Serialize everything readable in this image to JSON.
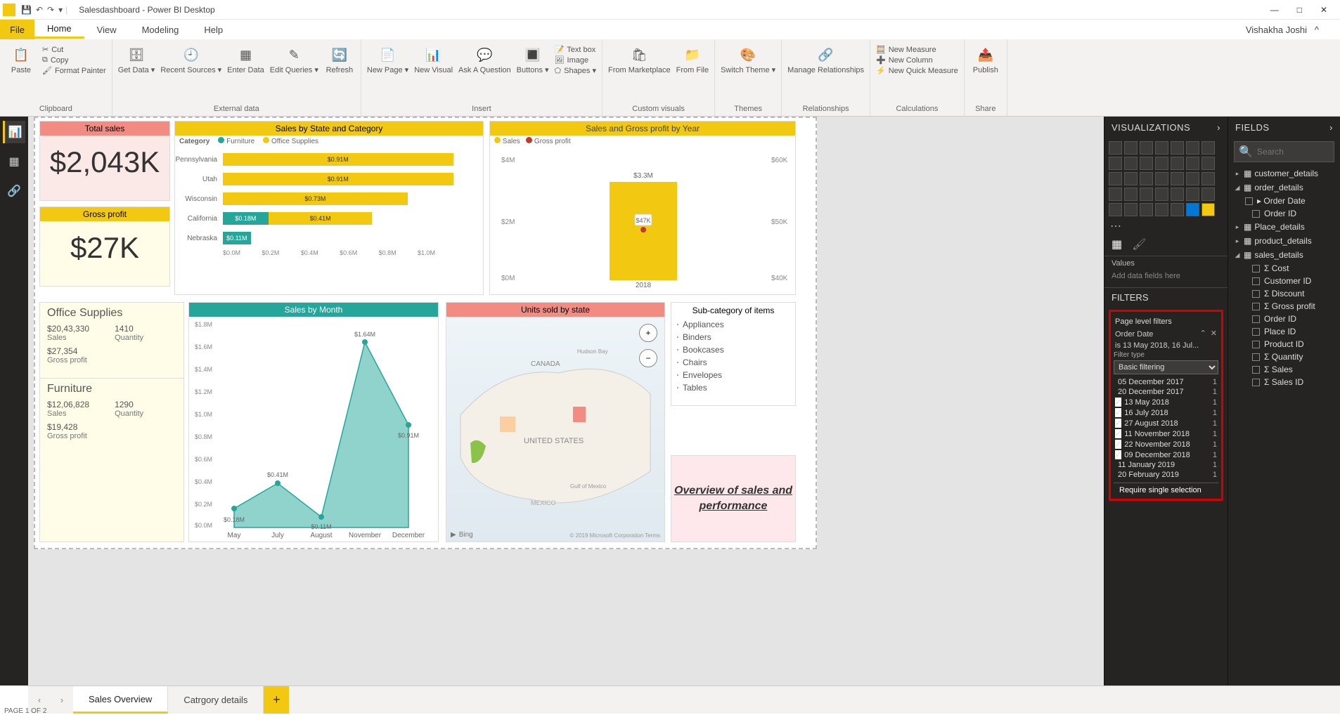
{
  "app": {
    "title": "Salesdashboard - Power BI Desktop",
    "user": "Vishakha Joshi"
  },
  "menu": {
    "file": "File",
    "tabs": [
      "Home",
      "View",
      "Modeling",
      "Help"
    ],
    "active": "Home"
  },
  "ribbon": {
    "clipboard": {
      "paste": "Paste",
      "cut": "Cut",
      "copy": "Copy",
      "format_painter": "Format Painter",
      "label": "Clipboard"
    },
    "external": {
      "get_data": "Get\nData ▾",
      "recent_sources": "Recent\nSources ▾",
      "enter_data": "Enter\nData",
      "edit_queries": "Edit\nQueries ▾",
      "refresh": "Refresh",
      "label": "External data"
    },
    "insert": {
      "new_page": "New\nPage ▾",
      "new_visual": "New\nVisual",
      "ask": "Ask A\nQuestion",
      "buttons": "Buttons\n▾",
      "textbox": "Text box",
      "image": "Image",
      "shapes": "Shapes ▾",
      "label": "Insert"
    },
    "custom": {
      "market": "From\nMarketplace",
      "file": "From\nFile",
      "label": "Custom visuals"
    },
    "themes": {
      "switch": "Switch\nTheme ▾",
      "label": "Themes"
    },
    "rel": {
      "manage": "Manage\nRelationships",
      "label": "Relationships"
    },
    "calc": {
      "new_measure": "New Measure",
      "new_column": "New Column",
      "new_quick": "New Quick Measure",
      "label": "Calculations"
    },
    "share": {
      "publish": "Publish",
      "label": "Share"
    }
  },
  "pane_viz": {
    "title": "VISUALIZATIONS",
    "values": "Values",
    "hint": "Add data fields here",
    "filters": "FILTERS",
    "page_filters": "Page level filters",
    "order_date": "Order Date",
    "summary": "is 13 May 2018, 16 Jul...",
    "filter_type_label": "Filter type",
    "filter_type": "Basic filtering",
    "dates": [
      {
        "label": "05 December 2017",
        "count": "1",
        "checked": false
      },
      {
        "label": "20 December 2017",
        "count": "1",
        "checked": false
      },
      {
        "label": "13 May 2018",
        "count": "1",
        "checked": true
      },
      {
        "label": "16 July 2018",
        "count": "1",
        "checked": true
      },
      {
        "label": "27 August 2018",
        "count": "1",
        "checked": true
      },
      {
        "label": "11 November 2018",
        "count": "1",
        "checked": true
      },
      {
        "label": "22 November 2018",
        "count": "1",
        "checked": true
      },
      {
        "label": "09 December 2018",
        "count": "1",
        "checked": true
      },
      {
        "label": "11 January 2019",
        "count": "1",
        "checked": false
      },
      {
        "label": "20 February 2019",
        "count": "1",
        "checked": false
      }
    ],
    "require_single": "Require single selection"
  },
  "pane_fields": {
    "title": "FIELDS",
    "search_placeholder": "Search",
    "tables": [
      {
        "name": "customer_details",
        "expanded": false
      },
      {
        "name": "order_details",
        "expanded": true,
        "fields": [
          {
            "name": "Order Date",
            "hierarchy": true
          },
          {
            "name": "Order ID"
          }
        ]
      },
      {
        "name": "Place_details",
        "expanded": false
      },
      {
        "name": "product_details",
        "expanded": false
      },
      {
        "name": "sales_details",
        "expanded": true,
        "fields": [
          {
            "name": "Cost",
            "sigma": true
          },
          {
            "name": "Customer ID"
          },
          {
            "name": "Discount",
            "sigma": true
          },
          {
            "name": "Gross profit",
            "sigma": true
          },
          {
            "name": "Order ID"
          },
          {
            "name": "Place ID"
          },
          {
            "name": "Product ID"
          },
          {
            "name": "Quantity",
            "sigma": true
          },
          {
            "name": "Sales",
            "sigma": true
          },
          {
            "name": "Sales ID",
            "sigma": true
          }
        ]
      }
    ]
  },
  "pagetabs": {
    "tabs": [
      "Sales Overview",
      "Catrgory details"
    ],
    "active": 0,
    "status": "PAGE 1 OF 2"
  },
  "tiles": {
    "total_sales": {
      "title": "Total sales",
      "value": "$2,043K"
    },
    "gross_profit": {
      "title": "Gross profit",
      "value": "$27K"
    },
    "sales_by_state": {
      "title": "Sales by State and Category",
      "legend_label": "Category",
      "series": [
        "Furniture",
        "Office Supplies"
      ]
    },
    "sales_year": {
      "title": "Sales and Gross profit by Year"
    },
    "office_card": {
      "title": "Office Supplies",
      "sales_v": "$20,43,330",
      "qty_v": "1410",
      "sales_l": "Sales",
      "qty_l": "Quantity",
      "gp_v": "$27,354",
      "gp_l": "Gross profit"
    },
    "furn_card": {
      "title": "Furniture",
      "sales_v": "$12,06,828",
      "qty_v": "1290",
      "sales_l": "Sales",
      "qty_l": "Quantity",
      "gp_v": "$19,428",
      "gp_l": "Gross profit"
    },
    "sales_month": {
      "title": "Sales by Month"
    },
    "map": {
      "title": "Units sold by state",
      "attrib": "© 2019 Microsoft Corporation Terms",
      "bing": "Bing"
    },
    "subcat": {
      "title": "Sub-category of items",
      "items": [
        "Appliances",
        "Binders",
        "Bookcases",
        "Chairs",
        "Envelopes",
        "Tables"
      ]
    },
    "overview": {
      "text": "Overview of sales and performance"
    }
  },
  "chart_data": [
    {
      "id": "sales_by_state",
      "type": "bar",
      "orientation": "horizontal",
      "stacked": true,
      "title": "Sales by State and Category",
      "xlabel": "",
      "ylabel": "",
      "xlim": [
        0,
        1.0
      ],
      "x_unit": "$M",
      "x_ticks": [
        "$0.0M",
        "$0.2M",
        "$0.4M",
        "$0.6M",
        "$0.8M",
        "$1.0M"
      ],
      "categories": [
        "Pennsylvania",
        "Utah",
        "Wisconsin",
        "California",
        "Nebraska"
      ],
      "series": [
        {
          "name": "Furniture",
          "color": "#26A69A",
          "values": [
            0,
            0,
            0,
            0.18,
            0.11
          ]
        },
        {
          "name": "Office Supplies",
          "color": "#F2C811",
          "values": [
            0.91,
            0.91,
            0.73,
            0.41,
            0
          ]
        }
      ],
      "data_labels": [
        "$0.91M",
        "$0.91M",
        "$0.73M",
        "$0.18M / $0.41M",
        "$0.11M"
      ]
    },
    {
      "id": "sales_gross_profit_year",
      "type": "bar",
      "title": "Sales and Gross profit by Year",
      "categories": [
        "2018"
      ],
      "series": [
        {
          "name": "Sales",
          "axis": "left",
          "color": "#F2C811",
          "values": [
            3.3
          ],
          "unit": "$M"
        },
        {
          "name": "Gross profit",
          "axis": "right",
          "color": "#C0392B",
          "values": [
            47
          ],
          "unit": "$K"
        }
      ],
      "y_left": {
        "label": "",
        "ticks": [
          "$0M",
          "$2M",
          "$4M"
        ],
        "lim": [
          0,
          4
        ]
      },
      "y_right": {
        "label": "",
        "ticks": [
          "$40K",
          "$50K",
          "$60K"
        ],
        "lim": [
          40,
          60
        ]
      },
      "data_labels": [
        "$3.3M",
        "$47K"
      ]
    },
    {
      "id": "sales_by_month",
      "type": "area",
      "title": "Sales by Month",
      "x": [
        "May",
        "July",
        "August",
        "November",
        "December"
      ],
      "values_M": [
        0.18,
        0.41,
        0.11,
        1.64,
        0.91
      ],
      "data_labels": [
        "$0.18M",
        "$0.41M",
        "$0.11M",
        "$1.64M",
        "$0.91M"
      ],
      "ylim": [
        0,
        1.8
      ],
      "y_unit": "$M",
      "y_ticks": [
        "$0.0M",
        "$0.2M",
        "$0.4M",
        "$0.6M",
        "$0.8M",
        "$1.0M",
        "$1.2M",
        "$1.4M",
        "$1.6M",
        "$1.8M"
      ],
      "color": "#8FD3CC"
    }
  ]
}
